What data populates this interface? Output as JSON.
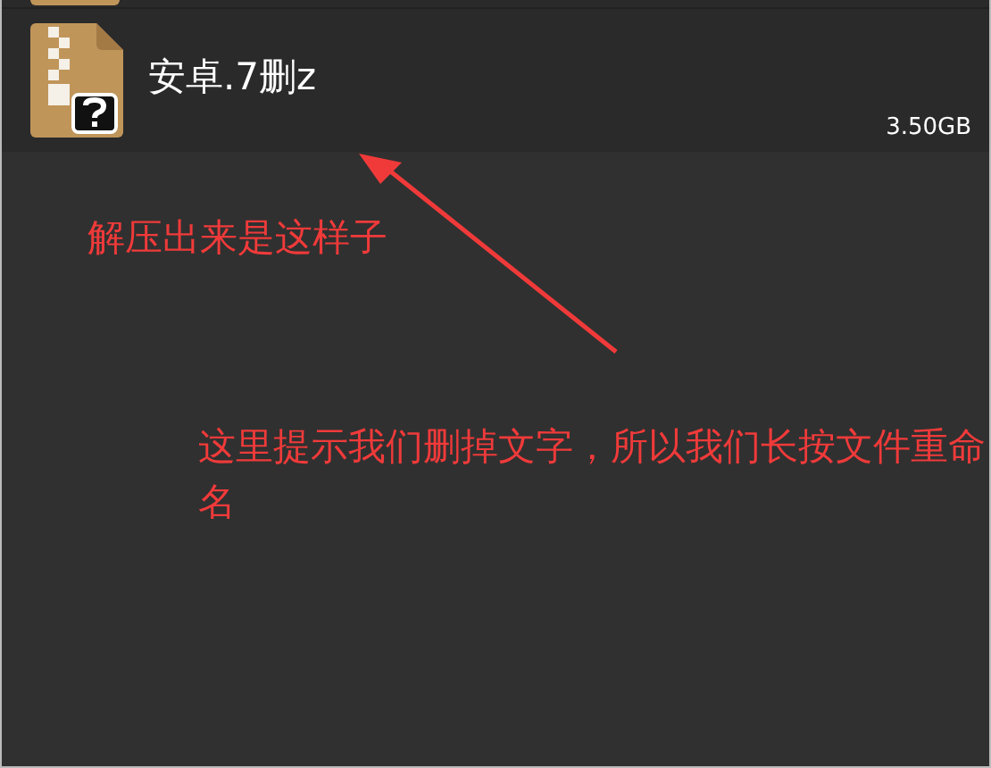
{
  "files": [
    {
      "name": "安卓.7删z",
      "size": "3.50GB"
    }
  ],
  "annotations": [
    {
      "text": "解压出来是这样子",
      "kind": "note"
    },
    {
      "text": "这里提示我们删掉文字，所以我们长按文件重命名",
      "kind": "note"
    }
  ]
}
